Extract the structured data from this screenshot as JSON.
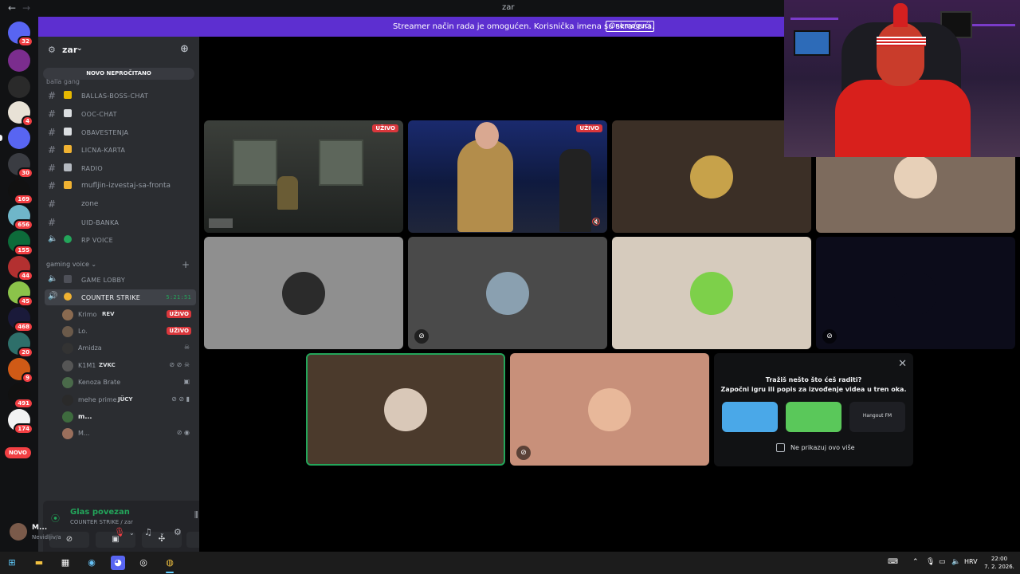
{
  "window": {
    "title": "zar",
    "back_icon": "←",
    "forward_icon": "→"
  },
  "banner": {
    "text": "Streamer način rada je omogućen. Korisnička imena su skraćena.",
    "button": "Onemogući"
  },
  "rail": {
    "servers": [
      {
        "name": "discord-home",
        "badge": "32"
      },
      {
        "name": "server-purple",
        "badge": ""
      },
      {
        "name": "server-dark",
        "badge": ""
      },
      {
        "name": "server-white",
        "badge": "4"
      },
      {
        "name": "server-z",
        "badge": ""
      },
      {
        "name": "server-speaker",
        "badge": "30"
      },
      {
        "name": "server-blank",
        "badge": "169"
      },
      {
        "name": "server-cyan",
        "badge": "656"
      },
      {
        "name": "server-green",
        "badge": "155"
      },
      {
        "name": "server-red",
        "badge": "44"
      },
      {
        "name": "server-lime",
        "badge": "45"
      },
      {
        "name": "server-f",
        "badge": "468"
      },
      {
        "name": "server-teal",
        "badge": "20"
      },
      {
        "name": "server-blkn",
        "badge": "9"
      },
      {
        "name": "server-z2",
        "badge": "491"
      },
      {
        "name": "server-swirl",
        "badge": "174"
      }
    ],
    "novo": "NOVO"
  },
  "guild": {
    "name": "zar"
  },
  "channels": {
    "new_unread": "NOVO NEPROČITANO",
    "cut_category": "balla gang",
    "text_channels": [
      {
        "label": "BALLAS-BOSS-CHAT",
        "emoji_color": "#e6b800"
      },
      {
        "label": "OOC-CHAT",
        "emoji_color": "#dbdee1"
      },
      {
        "label": "OBAVESTENJA",
        "emoji_color": "#dbdee1"
      },
      {
        "label": "LICNA-KARTA",
        "emoji_color": "#f0b232"
      },
      {
        "label": "RADIO",
        "emoji_color": "#b5bac1"
      },
      {
        "label": "mufljin-izvestaj-sa-fronta",
        "emoji_color": "#f0b232"
      },
      {
        "label": "zone",
        "emoji_color": ""
      },
      {
        "label": "UID-BANKA",
        "emoji_color": ""
      },
      {
        "label": "RP VOICE",
        "emoji_color": "#23a55a"
      }
    ],
    "voice_category": "gaming voice",
    "game_lobby": "GAME LOBBY",
    "active_voice": "COUNTER STRIKE",
    "active_timer": "5:21:51",
    "members": [
      {
        "name": "Krimo",
        "tag": "REV",
        "live": "UŽIVO",
        "icon": ""
      },
      {
        "name": "Lo.",
        "tag": "",
        "live": "UŽIVO",
        "icon": ""
      },
      {
        "name": "Amidza",
        "tag": "",
        "live": "",
        "icon": "☠"
      },
      {
        "name": "K1M1",
        "tag": "ZVKC",
        "live": "",
        "icon": "⊘ ⊘ ☠"
      },
      {
        "name": "Kenoza Brate",
        "tag": "",
        "live": "",
        "icon": "▣"
      },
      {
        "name": "mehe prime",
        "tag": "JÜCY",
        "live": "",
        "icon": "⊘ ⊘ ▮"
      },
      {
        "name": "m...",
        "tag": "",
        "live": "",
        "icon": ""
      },
      {
        "name": "M...",
        "tag": "",
        "live": "",
        "icon": "⊘ ◉"
      }
    ]
  },
  "voice_panel": {
    "status": "Glas povezan",
    "channel": "COUNTER STRIKE / zar"
  },
  "user": {
    "name": "M...",
    "status": "Nevidljiv/a"
  },
  "stage": {
    "live_label": "UŽIVO",
    "tile_colors": {
      "t3": "#3b2f26",
      "t4": "#7d6b5d",
      "t5": "#8f8f8f",
      "t6": "#4a4a4a",
      "t7": "#d6cbbd",
      "t8": "#0c0c1a",
      "t9": "#4b3a2c",
      "t10": "#c8907a"
    }
  },
  "suggest": {
    "line1": "Tražiš nešto što ćeš raditi?",
    "line2": "Započni igru ili popis za izvođenje videa u tren oka.",
    "activities": [
      "",
      "",
      "Hangout FM"
    ],
    "dont_show": "Ne prikazuj ovo više"
  },
  "taskbar": {
    "lang": "HRV",
    "time": "22:00",
    "date": "7. 2. 2026."
  }
}
